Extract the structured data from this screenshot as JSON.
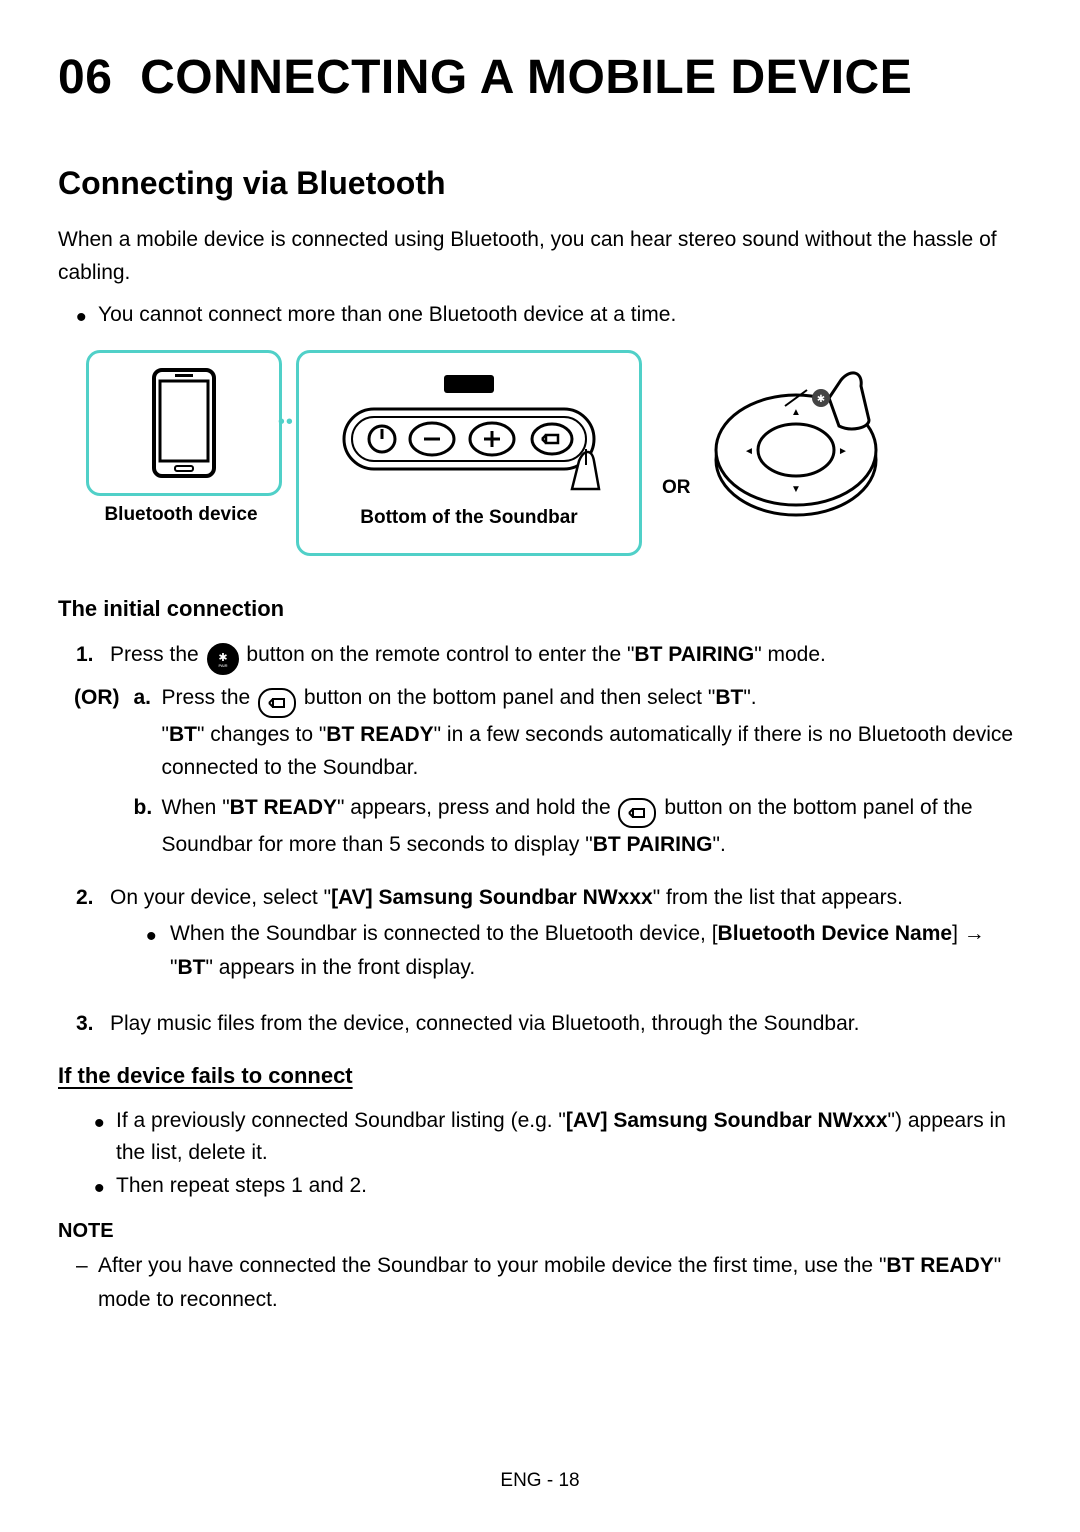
{
  "chapter": {
    "number": "06",
    "title": "CONNECTING A MOBILE DEVICE"
  },
  "section": {
    "title": "Connecting via Bluetooth",
    "intro": "When a mobile device is connected using Bluetooth, you can hear stereo sound without the hassle of cabling.",
    "bullet1": "You cannot connect more than one Bluetooth device at a time."
  },
  "diagram": {
    "bt_device_label": "Bluetooth device",
    "soundbar_label": "Bottom of the Soundbar",
    "or_label": "OR"
  },
  "initial": {
    "heading": "The initial connection",
    "step1_pre": "Press the ",
    "step1_post": " button on the remote control to enter the \"",
    "step1_mode": "BT PAIRING",
    "step1_end": "\" mode.",
    "or_tag": "(OR)",
    "a_pre": "Press the ",
    "a_post": " button on the bottom panel and then select \"",
    "a_bt": "BT",
    "a_end": "\".",
    "a_line2_q1": "\"",
    "a_line2_bt": "BT",
    "a_line2_mid": "\" changes to \"",
    "a_line2_ready": "BT READY",
    "a_line2_end": "\" in a few seconds automatically if there is no Bluetooth device connected to the Soundbar.",
    "b_pre": "When \"",
    "b_ready": "BT READY",
    "b_mid": "\" appears, press and hold the ",
    "b_post": " button on the bottom panel of the Soundbar for more than 5 seconds to display \"",
    "b_pair": "BT PAIRING",
    "b_end": "\".",
    "step2_pre": "On your device, select \"",
    "step2_dev": "[AV] Samsung Soundbar NWxxx",
    "step2_post": "\" from the list that appears.",
    "step2_sub_pre": "When the Soundbar is connected to the Bluetooth device, [",
    "step2_sub_name": "Bluetooth Device Name",
    "step2_sub_mid": "] → \"",
    "step2_sub_bt": "BT",
    "step2_sub_end": "\" appears in the front display.",
    "step3": "Play music files from the device, connected via Bluetooth, through the Soundbar."
  },
  "fail": {
    "heading": "If the device fails to connect",
    "b1_pre": "If a previously connected Soundbar listing (e.g. \"",
    "b1_dev": "[AV] Samsung Soundbar NWxxx",
    "b1_post": "\") appears in the list, delete it.",
    "b2": "Then repeat steps 1 and 2."
  },
  "note": {
    "heading": "NOTE",
    "line_pre": "After you have connected the Soundbar to your mobile device the first time, use the \"",
    "line_ready": "BT READY",
    "line_post": "\" mode to reconnect."
  },
  "footer": "ENG - 18"
}
